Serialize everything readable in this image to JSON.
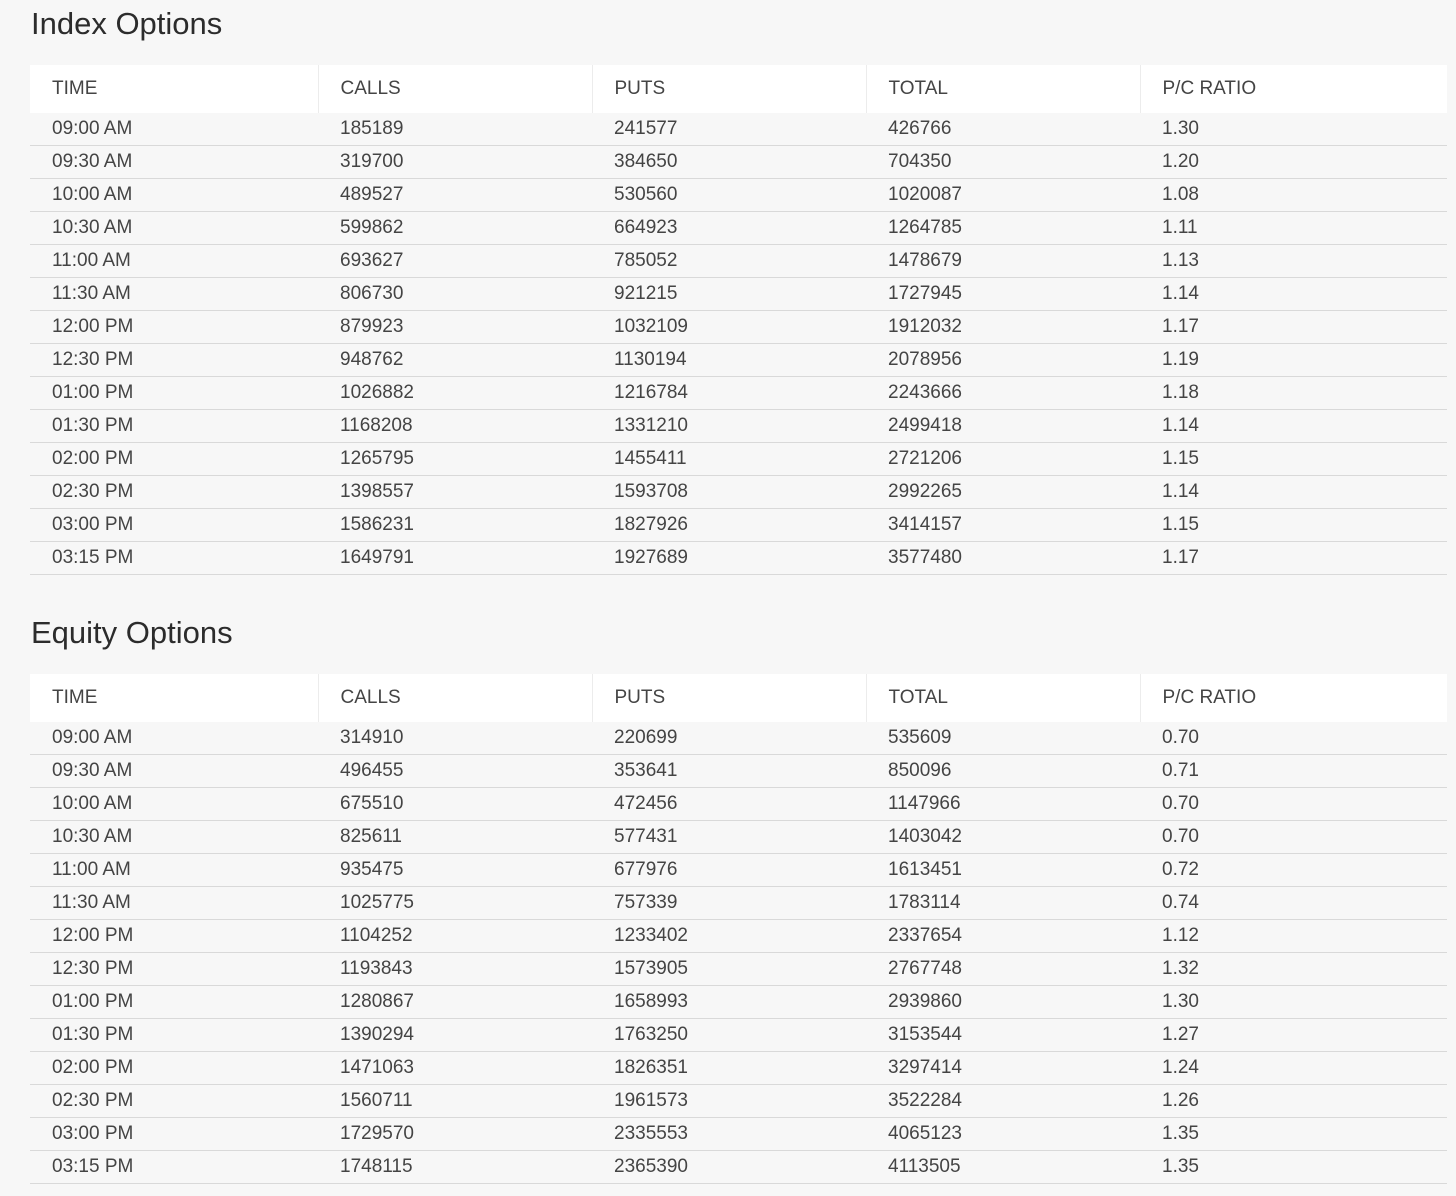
{
  "sections": [
    {
      "title": "Index Options",
      "columns": [
        "TIME",
        "CALLS",
        "PUTS",
        "TOTAL",
        "P/C RATIO"
      ],
      "rows": [
        [
          "09:00 AM",
          "185189",
          "241577",
          "426766",
          "1.30"
        ],
        [
          "09:30 AM",
          "319700",
          "384650",
          "704350",
          "1.20"
        ],
        [
          "10:00 AM",
          "489527",
          "530560",
          "1020087",
          "1.08"
        ],
        [
          "10:30 AM",
          "599862",
          "664923",
          "1264785",
          "1.11"
        ],
        [
          "11:00 AM",
          "693627",
          "785052",
          "1478679",
          "1.13"
        ],
        [
          "11:30 AM",
          "806730",
          "921215",
          "1727945",
          "1.14"
        ],
        [
          "12:00 PM",
          "879923",
          "1032109",
          "1912032",
          "1.17"
        ],
        [
          "12:30 PM",
          "948762",
          "1130194",
          "2078956",
          "1.19"
        ],
        [
          "01:00 PM",
          "1026882",
          "1216784",
          "2243666",
          "1.18"
        ],
        [
          "01:30 PM",
          "1168208",
          "1331210",
          "2499418",
          "1.14"
        ],
        [
          "02:00 PM",
          "1265795",
          "1455411",
          "2721206",
          "1.15"
        ],
        [
          "02:30 PM",
          "1398557",
          "1593708",
          "2992265",
          "1.14"
        ],
        [
          "03:00 PM",
          "1586231",
          "1827926",
          "3414157",
          "1.15"
        ],
        [
          "03:15 PM",
          "1649791",
          "1927689",
          "3577480",
          "1.17"
        ]
      ]
    },
    {
      "title": "Equity Options",
      "columns": [
        "TIME",
        "CALLS",
        "PUTS",
        "TOTAL",
        "P/C RATIO"
      ],
      "rows": [
        [
          "09:00 AM",
          "314910",
          "220699",
          "535609",
          "0.70"
        ],
        [
          "09:30 AM",
          "496455",
          "353641",
          "850096",
          "0.71"
        ],
        [
          "10:00 AM",
          "675510",
          "472456",
          "1147966",
          "0.70"
        ],
        [
          "10:30 AM",
          "825611",
          "577431",
          "1403042",
          "0.70"
        ],
        [
          "11:00 AM",
          "935475",
          "677976",
          "1613451",
          "0.72"
        ],
        [
          "11:30 AM",
          "1025775",
          "757339",
          "1783114",
          "0.74"
        ],
        [
          "12:00 PM",
          "1104252",
          "1233402",
          "2337654",
          "1.12"
        ],
        [
          "12:30 PM",
          "1193843",
          "1573905",
          "2767748",
          "1.32"
        ],
        [
          "01:00 PM",
          "1280867",
          "1658993",
          "2939860",
          "1.30"
        ],
        [
          "01:30 PM",
          "1390294",
          "1763250",
          "3153544",
          "1.27"
        ],
        [
          "02:00 PM",
          "1471063",
          "1826351",
          "3297414",
          "1.24"
        ],
        [
          "02:30 PM",
          "1560711",
          "1961573",
          "3522284",
          "1.26"
        ],
        [
          "03:00 PM",
          "1729570",
          "2335553",
          "4065123",
          "1.35"
        ],
        [
          "03:15 PM",
          "1748115",
          "2365390",
          "4113505",
          "1.35"
        ]
      ]
    }
  ]
}
